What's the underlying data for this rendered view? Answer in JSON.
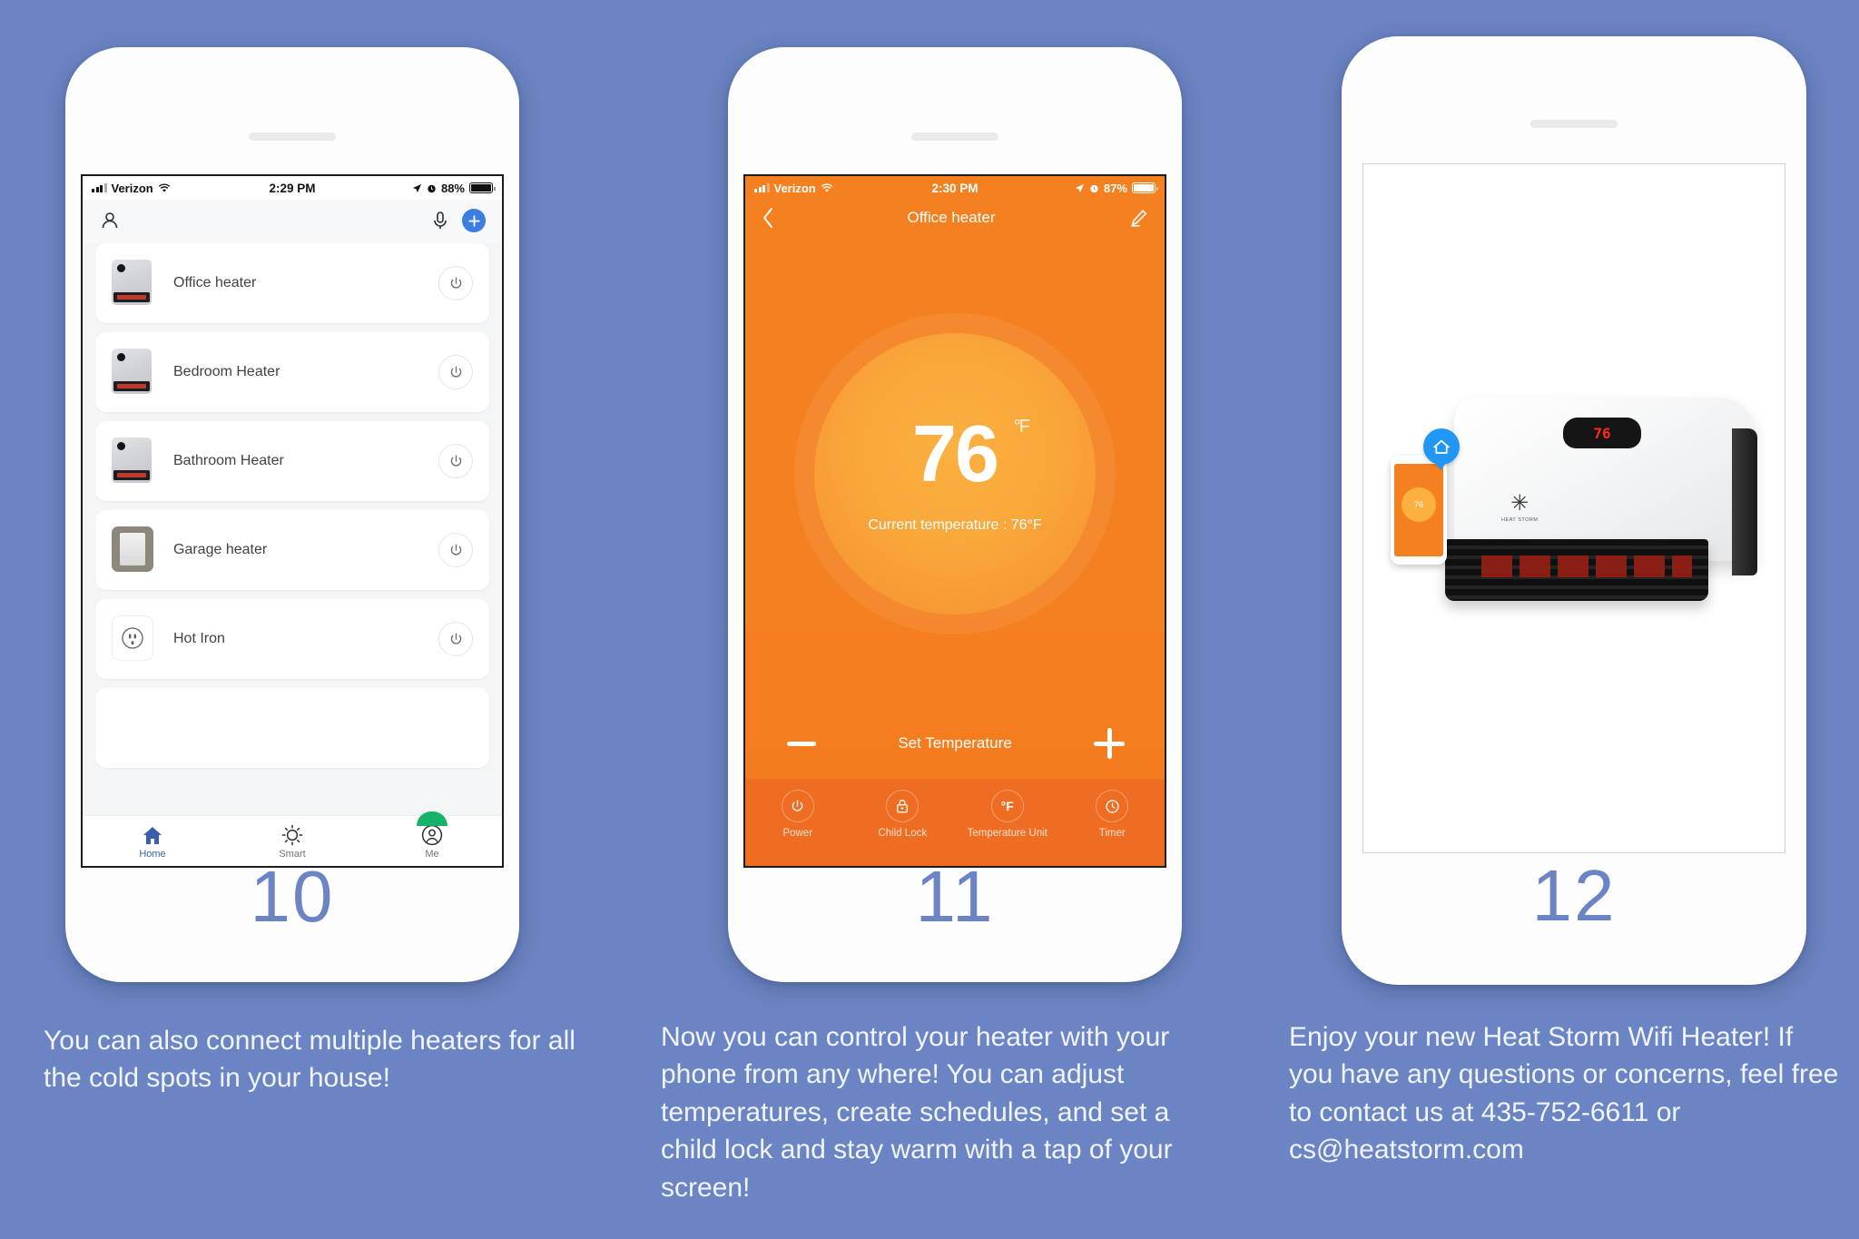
{
  "theme": {
    "background": "#6b85c4",
    "accent_blue": "#3b7de0",
    "accent_orange": "#f58020",
    "orange_dark": "#ef6c23",
    "ring_orange": "#fbb040",
    "page_number_color": "#6b85c4"
  },
  "panels": [
    {
      "page_number": "10",
      "caption": "You can also connect multiple heaters for all the cold spots in your house!",
      "status_bar": {
        "carrier": "Verizon",
        "time": "2:29 PM",
        "battery": "88%",
        "wifi_icon": "wifi-icon",
        "location_icon": "location-arrow-icon",
        "alarm_icon": "alarm-clock-icon",
        "signal_icon": "signal-bars-icon",
        "battery_icon": "battery-icon"
      },
      "header": {
        "profile_icon": "person-icon",
        "mic_icon": "microphone-icon",
        "add_icon": "plus-icon"
      },
      "devices": [
        {
          "name": "Office heater",
          "icon": "heater-icon",
          "power_icon": "power-icon"
        },
        {
          "name": "Bedroom Heater",
          "icon": "heater-icon",
          "power_icon": "power-icon"
        },
        {
          "name": "Bathroom Heater",
          "icon": "heater-icon",
          "power_icon": "power-icon"
        },
        {
          "name": "Garage heater",
          "icon": "wall-switch-icon",
          "power_icon": "power-icon"
        },
        {
          "name": "Hot Iron",
          "icon": "outlet-icon",
          "power_icon": "power-icon"
        }
      ],
      "tabs": [
        {
          "label": "Home",
          "icon": "home-icon",
          "active": true
        },
        {
          "label": "Smart",
          "icon": "sun-icon",
          "active": false
        },
        {
          "label": "Me",
          "icon": "person-circle-icon",
          "active": false
        }
      ]
    },
    {
      "page_number": "11",
      "caption": "Now you can control your heater with your phone from any where! You can adjust temperatures, create schedules, and set a child lock and stay warm with a tap of your screen!",
      "status_bar": {
        "carrier": "Verizon",
        "time": "2:30 PM",
        "battery": "87%",
        "wifi_icon": "wifi-icon",
        "location_icon": "location-arrow-icon",
        "alarm_icon": "alarm-clock-icon",
        "signal_icon": "signal-bars-icon",
        "battery_icon": "battery-icon"
      },
      "nav": {
        "back_icon": "chevron-left-icon",
        "title": "Office heater",
        "edit_icon": "pencil-icon"
      },
      "dial": {
        "value": "76",
        "unit": "°F",
        "current_label": "Current temperature : 76°F"
      },
      "set_row": {
        "label": "Set Temperature",
        "minus_icon": "minus-icon",
        "plus_icon": "plus-icon"
      },
      "controls": [
        {
          "label": "Power",
          "icon": "power-icon"
        },
        {
          "label": "Child Lock",
          "icon": "lock-icon"
        },
        {
          "label": "Temperature Unit",
          "icon": "degree-f-icon",
          "glyph": "°F"
        },
        {
          "label": "Timer",
          "icon": "clock-icon"
        }
      ]
    },
    {
      "page_number": "12",
      "caption": "Enjoy your new Heat Storm Wifi Heater! If you have any questions or concerns, feel free to contact us at 435-752-6611 or cs@heatstorm.com",
      "product": {
        "display_value": "76",
        "brand": "HEAT STORM",
        "mini_phone_value": "76",
        "badge_icon": "smart-home-wifi-icon",
        "heater_icon": "wall-heater-product-image"
      }
    }
  ]
}
